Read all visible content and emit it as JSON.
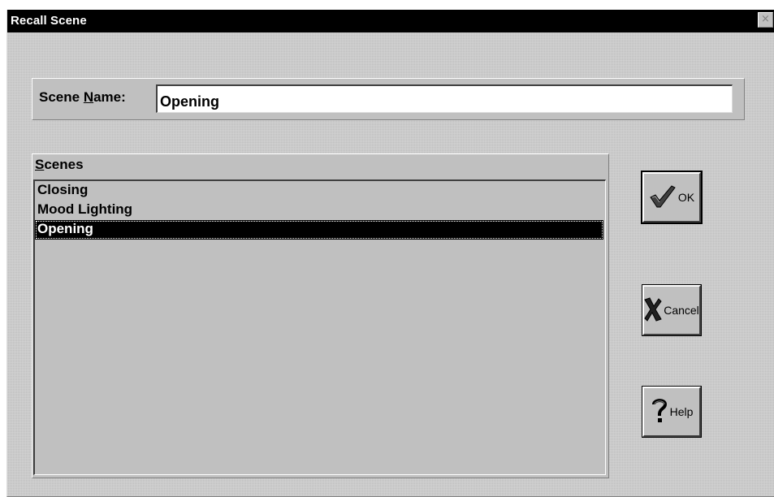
{
  "window": {
    "title": "Recall Scene",
    "close_glyph": "×"
  },
  "scene_name": {
    "label_pre": "Scene ",
    "label_mnemonic": "N",
    "label_post": "ame:",
    "value": "Opening"
  },
  "scenes": {
    "label_mnemonic": "S",
    "label_rest": "cenes",
    "items": [
      {
        "label": "Closing",
        "selected": false
      },
      {
        "label": "Mood Lighting",
        "selected": false
      },
      {
        "label": "Opening",
        "selected": true
      }
    ]
  },
  "buttons": {
    "ok": {
      "label": "OK",
      "icon": "checkmark-icon"
    },
    "cancel": {
      "label": "Cancel",
      "icon": "x-mark-icon"
    },
    "help": {
      "label": "Help",
      "icon": "question-mark-icon"
    }
  },
  "colors": {
    "face": "#c0c0c0",
    "selection": "#000000",
    "title_bar": "#000000"
  }
}
